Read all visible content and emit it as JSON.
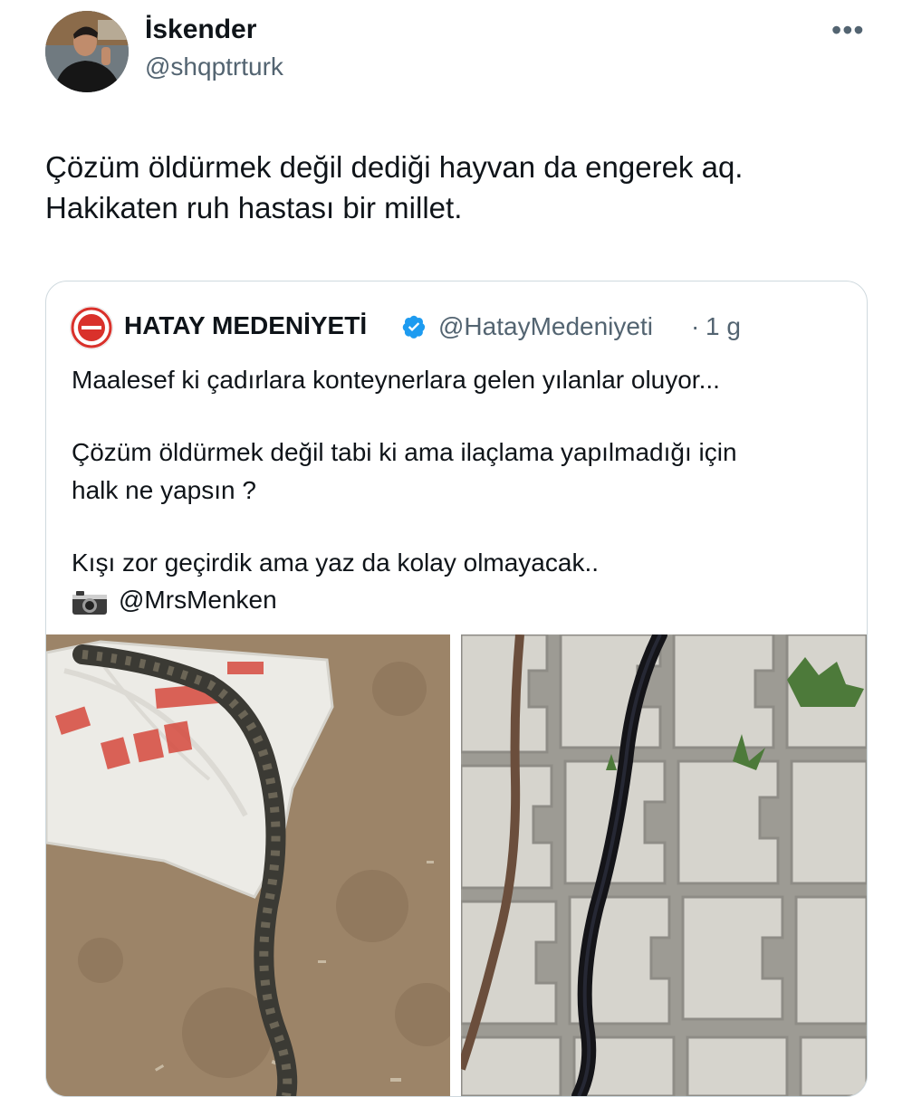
{
  "author": {
    "display_name": "İskender",
    "handle": "@shqptrturk",
    "avatar_icon": "profile-photo"
  },
  "more_icon": "•••",
  "tweet_text": "Çözüm öldürmek değil dediği hayvan da engerek aq.\nHakikaten ruh hastası bir millet.",
  "quoted": {
    "name": "HATAY MEDENİYETİ",
    "verified_icon": "verified-badge",
    "handle": "@HatayMedeniyeti",
    "dot": "·",
    "time": "1 g",
    "lines": [
      "Maalesef ki çadırlara konteynerlara gelen yılanlar oluyor...",
      "Çözüm öldürmek değil tabi ki ama ilaçlama yapılmadığı için",
      "halk ne yapsın ?",
      "Kışı zor geçirdik ama yaz da kolay olmayacak.."
    ],
    "credit": "@MrsMenken",
    "camera_icon": "camera-icon",
    "photos": [
      {
        "desc": "snake-on-sack"
      },
      {
        "desc": "black-snake-on-pavers"
      }
    ]
  }
}
